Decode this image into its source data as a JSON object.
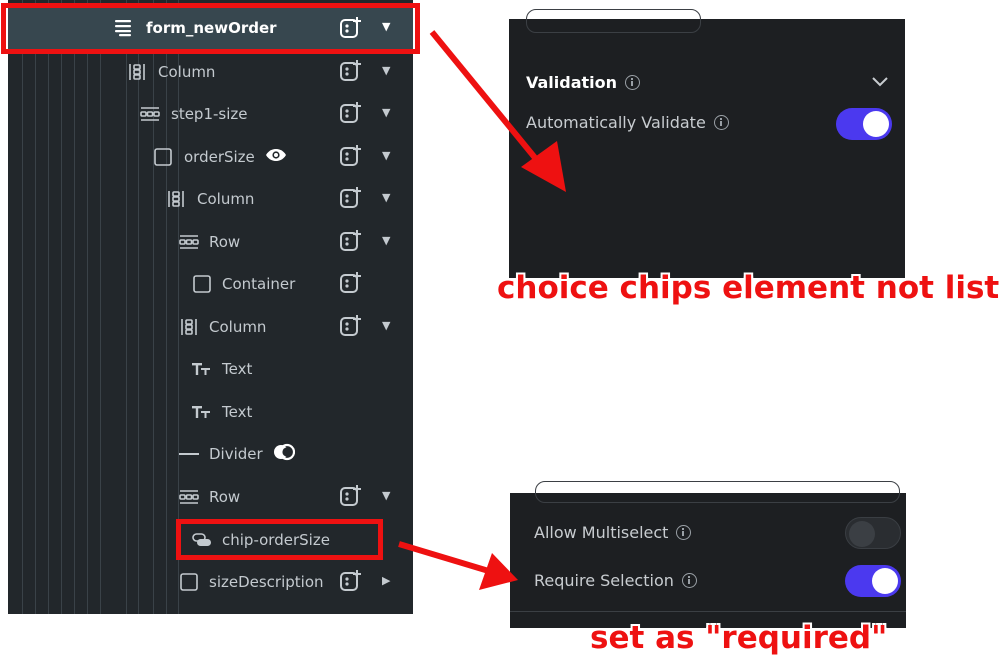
{
  "tree": {
    "nodes": [
      {
        "label": "form_newOrder",
        "icon": "form-icon",
        "selected": true,
        "add": true,
        "caret": "down"
      },
      {
        "label": "Column",
        "icon": "column-icon",
        "add": true,
        "caret": "down"
      },
      {
        "label": "step1-size",
        "icon": "row-icon",
        "add": true,
        "caret": "down"
      },
      {
        "label": "orderSize",
        "icon": "container-icon",
        "add": true,
        "caret": "down",
        "badge": "eye-icon"
      },
      {
        "label": "Column",
        "icon": "column-icon",
        "add": true,
        "caret": "down"
      },
      {
        "label": "Row",
        "icon": "row-icon",
        "add": true,
        "caret": "down"
      },
      {
        "label": "Container",
        "icon": "container-icon",
        "add": true
      },
      {
        "label": "Column",
        "icon": "column-icon",
        "add": true,
        "caret": "down"
      },
      {
        "label": "Text",
        "icon": "text-icon"
      },
      {
        "label": "Text",
        "icon": "text-icon"
      },
      {
        "label": "Divider",
        "icon": "divider-icon",
        "badge": "component-icon"
      },
      {
        "label": "Row",
        "icon": "row-icon",
        "add": true,
        "caret": "down"
      },
      {
        "label": "chip-orderSize",
        "icon": "chips-icon"
      },
      {
        "label": "sizeDescription",
        "icon": "container-icon",
        "add": true,
        "caret": "right"
      }
    ]
  },
  "validation_panel": {
    "title": "Validation",
    "auto_validate_label": "Automatically Validate",
    "auto_validate_on": true
  },
  "chips_panel": {
    "allow_multiselect_label": "Allow Multiselect",
    "allow_multiselect_on": false,
    "require_selection_label": "Require Selection",
    "require_selection_on": true
  },
  "annotations": {
    "not_listed": "choice chips element not listed",
    "required": "set as \"required\""
  },
  "colors": {
    "accent": "#4b39ef",
    "annotation_red": "#ee1111",
    "panel_bg": "#1d1f22",
    "tree_bg": "#22272b",
    "selected_row": "#37474f"
  }
}
